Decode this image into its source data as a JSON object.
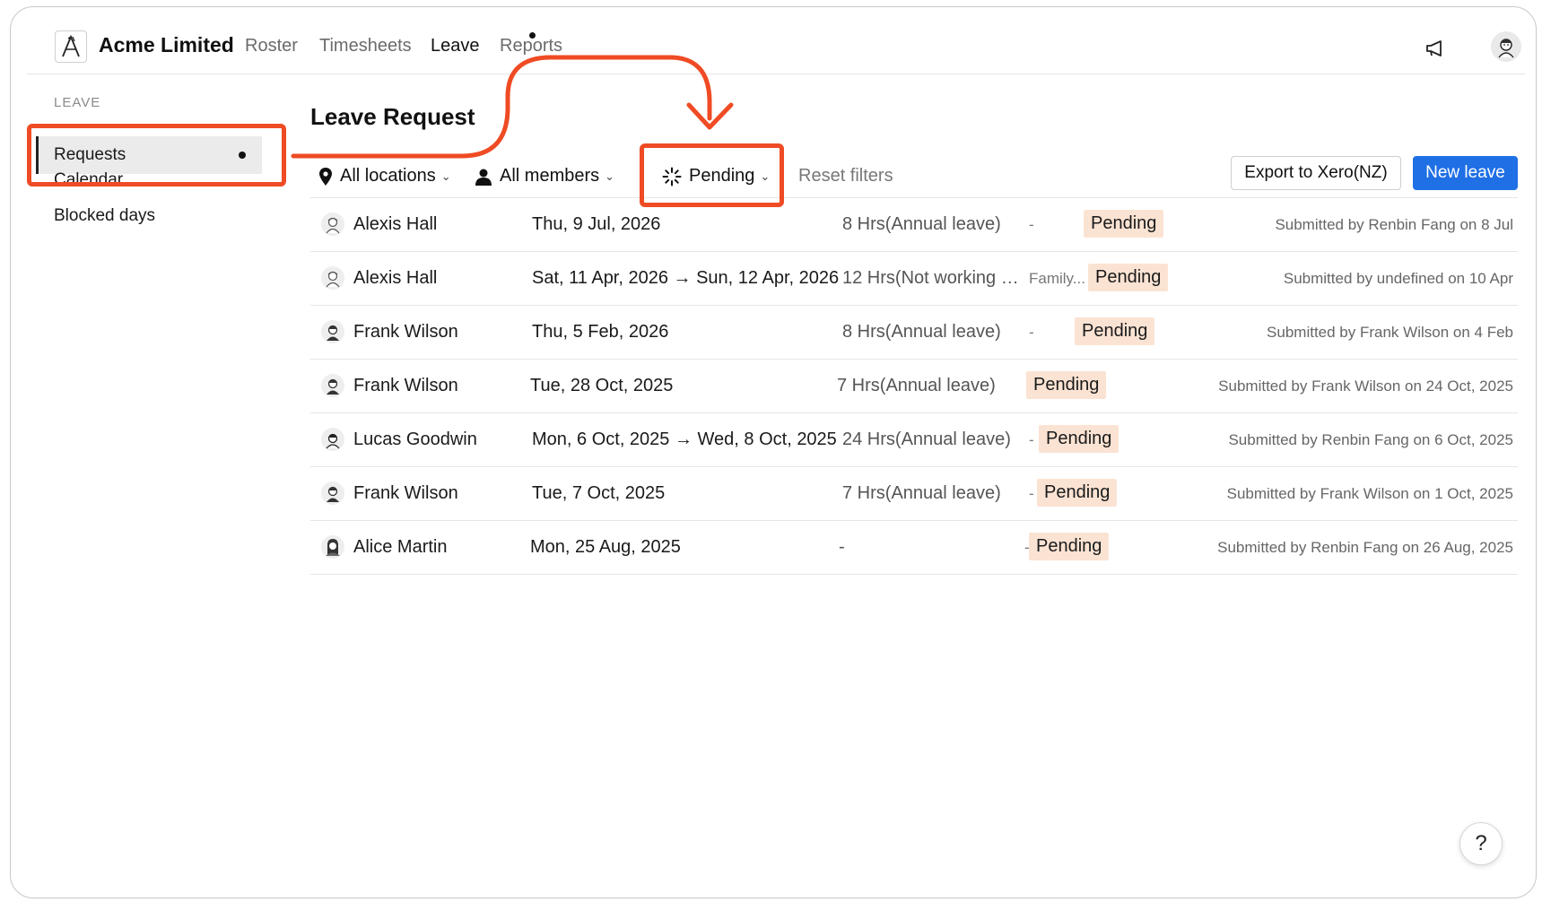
{
  "header": {
    "company": "Acme Limited",
    "nav": [
      {
        "label": "Roster"
      },
      {
        "label": "Timesheets"
      },
      {
        "label": "Leave"
      },
      {
        "label": "Reports"
      }
    ],
    "icons": [
      "logo-icon",
      "megaphone-icon",
      "user-avatar"
    ]
  },
  "sidebar": {
    "section": "LEAVE",
    "items": [
      {
        "label": "Requests"
      },
      {
        "label": "Calendar"
      },
      {
        "label": "Blocked days"
      }
    ]
  },
  "main": {
    "title": "Leave Request",
    "filters": {
      "location": "All locations",
      "members": "All members",
      "status": "Pending",
      "reset": "Reset filters"
    },
    "buttons": {
      "export": "Export to Xero(NZ)",
      "new": "New leave"
    },
    "rows": [
      {
        "name": "Alexis Hall",
        "date": "Thu, 9 Jul, 2026",
        "hours": "8 Hrs(Annual leave)",
        "note": "-",
        "status": "Pending",
        "submitted": "Submitted by Renbin Fang on 8 Jul"
      },
      {
        "name": "Alexis Hall",
        "date": "Sat, 11 Apr, 2026 → Sun, 12 Apr, 2026",
        "hours": "12 Hrs(Not working da...",
        "note": "Family...",
        "status": "Pending",
        "submitted": "Submitted by undefined on 10 Apr"
      },
      {
        "name": "Frank Wilson",
        "date": "Thu, 5 Feb, 2026",
        "hours": "8 Hrs(Annual leave)",
        "note": "-",
        "status": "Pending",
        "submitted": "Submitted by Frank Wilson on 4 Feb"
      },
      {
        "name": "Frank Wilson",
        "date": "Tue, 28 Oct, 2025",
        "hours": "7 Hrs(Annual leave)",
        "note": "",
        "status": "Pending",
        "submitted": "Submitted by Frank Wilson on 24 Oct, 2025"
      },
      {
        "name": "Lucas Goodwin",
        "date": "Mon, 6 Oct, 2025 → Wed, 8 Oct, 2025",
        "hours": "24 Hrs(Annual leave)",
        "note": "-",
        "status": "Pending",
        "submitted": "Submitted by Renbin Fang on 6 Oct, 2025"
      },
      {
        "name": "Frank Wilson",
        "date": "Tue, 7 Oct, 2025",
        "hours": "7 Hrs(Annual leave)",
        "note": "-",
        "status": "Pending",
        "submitted": "Submitted by Frank Wilson on 1 Oct, 2025"
      },
      {
        "name": "Alice Martin",
        "date": "Mon, 25 Aug, 2025",
        "hours": "-",
        "note": "-",
        "status": "Pending",
        "submitted": "Submitted by Renbin Fang on 26 Aug, 2025"
      }
    ]
  },
  "help": "?",
  "colors": {
    "accent": "#1f6fe5",
    "annotation": "#ef4b24",
    "pending_bg": "#fbe3d3"
  }
}
